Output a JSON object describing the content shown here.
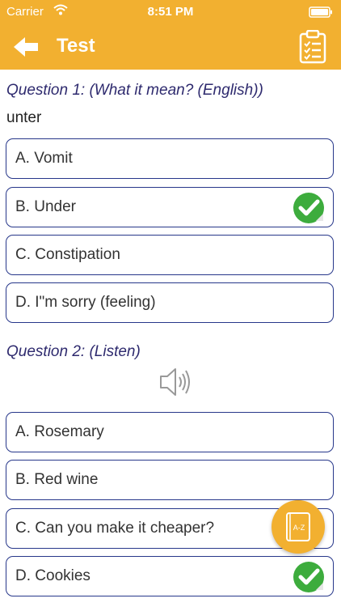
{
  "status_bar": {
    "carrier": "Carrier",
    "time": "8:51 PM"
  },
  "nav": {
    "title": "Test",
    "back_icon": "back-arrow-icon",
    "right_icon": "clipboard-checklist-icon"
  },
  "questions": [
    {
      "label": "Question 1: (What it mean? (English))",
      "word": "unter",
      "options": [
        {
          "text": "A. Vomit",
          "correct": false
        },
        {
          "text": "B. Under",
          "correct": true
        },
        {
          "text": "C. Constipation",
          "correct": false
        },
        {
          "text": "D. I\"m sorry (feeling)",
          "correct": false
        }
      ]
    },
    {
      "label": "Question 2: (Listen)",
      "audio_icon": "speaker-icon",
      "options": [
        {
          "text": "A. Rosemary",
          "correct": false
        },
        {
          "text": "B. Red wine",
          "correct": false
        },
        {
          "text": "C. Can you make it cheaper?",
          "correct": false
        },
        {
          "text": "D. Cookies",
          "correct": true
        }
      ]
    }
  ],
  "fab": {
    "icon": "a-z-dictionary-icon",
    "label": "A-Z"
  },
  "colors": {
    "accent": "#f2b030",
    "border": "#27378a",
    "question_text": "#2e2a6e",
    "check": "#3dac3d"
  }
}
